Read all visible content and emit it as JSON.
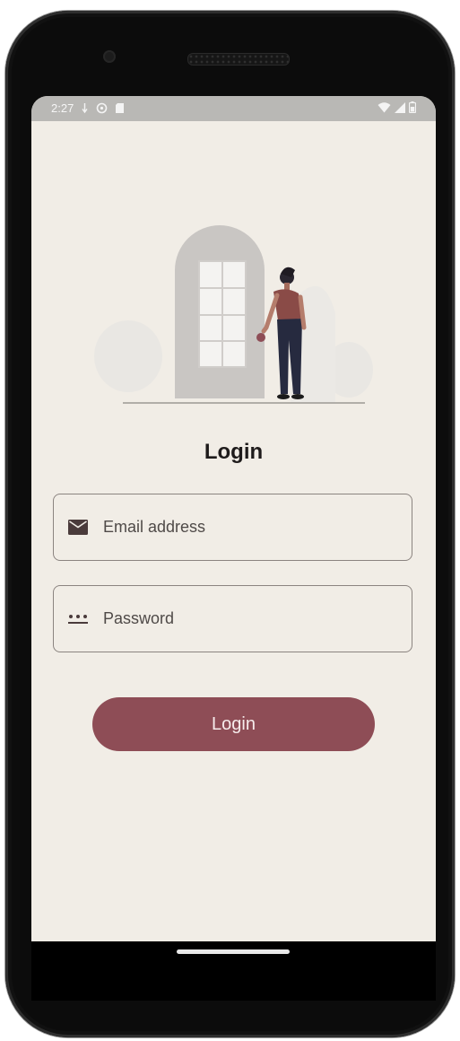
{
  "status_bar": {
    "time": "2:27",
    "left_icons": [
      "location-icon",
      "alarm-icon",
      "sd-card-icon"
    ],
    "right_icons": [
      "wifi-icon",
      "signal-icon",
      "battery-icon"
    ]
  },
  "login": {
    "title": "Login",
    "email_placeholder": "Email address",
    "password_placeholder": "Password",
    "button_label": "Login"
  },
  "theme": {
    "screen_bg": "#f1ede6",
    "accent": "#8e4d56",
    "text": "#1e1b1b"
  },
  "icons": {
    "email_icon": "mail-icon",
    "password_icon": "password-dots-icon",
    "illustration": "person-at-door-illustration"
  }
}
